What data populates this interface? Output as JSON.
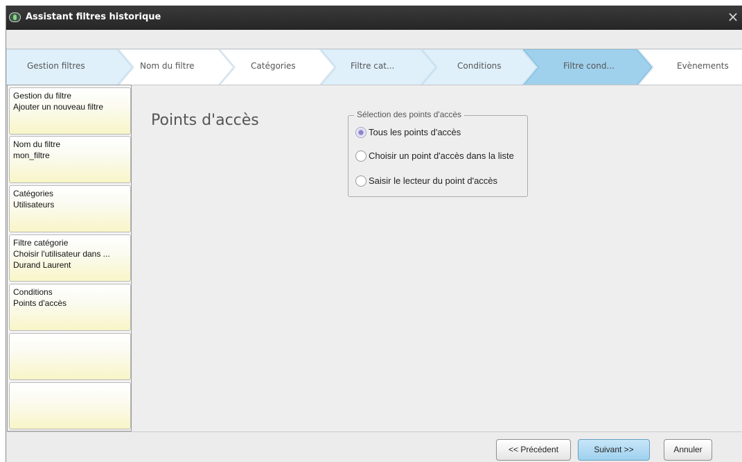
{
  "window": {
    "title": "Assistant filtres historique",
    "close_glyph": "×",
    "app_icon": "app-icon"
  },
  "steps": [
    {
      "label": "Gestion filtres",
      "state": "done"
    },
    {
      "label": "Nom du filtre",
      "state": "todo"
    },
    {
      "label": "Catégories",
      "state": "todo"
    },
    {
      "label": "Filtre cat...",
      "state": "done"
    },
    {
      "label": "Conditions",
      "state": "done"
    },
    {
      "label": "Filtre cond...",
      "state": "active"
    },
    {
      "label": "Evènements",
      "state": "todo"
    }
  ],
  "sidebar": {
    "cards": [
      {
        "lines": [
          "Gestion du filtre",
          "Ajouter un nouveau filtre"
        ]
      },
      {
        "lines": [
          "Nom du filtre",
          "mon_filtre"
        ]
      },
      {
        "lines": [
          "Catégories",
          "Utilisateurs"
        ]
      },
      {
        "lines": [
          "Filtre catégorie",
          "Choisir l'utilisateur dans ...",
          "Durand Laurent"
        ]
      },
      {
        "lines": [
          "Conditions",
          "Points d'accès"
        ]
      },
      {
        "lines": []
      },
      {
        "lines": []
      }
    ]
  },
  "main": {
    "title": "Points d'accès",
    "group": {
      "legend": "Sélection des points d'accès",
      "options": [
        {
          "label": "Tous les points d'accès",
          "checked": true
        },
        {
          "label": "Choisir un point d'accès dans la liste",
          "checked": false
        },
        {
          "label": "Saisir le lecteur du point d'accès",
          "checked": false
        }
      ]
    }
  },
  "footer": {
    "previous": "<< Précédent",
    "next": "Suivant >>",
    "cancel": "Annuler"
  },
  "colors": {
    "titlebar": "#2f2f2f",
    "active_step": "#9fd0ec",
    "step_done": "#dff0fb",
    "card_yellow": "#f8f5c7",
    "primary_button": "#a7d5f0"
  }
}
